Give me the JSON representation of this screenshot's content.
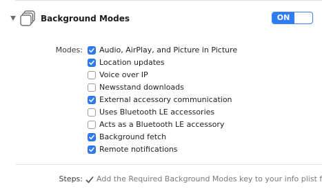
{
  "capability": {
    "title": "Background Modes",
    "toggle_label": "ON",
    "toggle_state": "on",
    "icon": "layered-squares-icon",
    "disclosure_icon": "disclosure-triangle-down-icon"
  },
  "modes": {
    "label": "Modes:",
    "items": [
      {
        "label": "Audio, AirPlay, and Picture in Picture",
        "checked": true
      },
      {
        "label": "Location updates",
        "checked": true
      },
      {
        "label": "Voice over IP",
        "checked": false
      },
      {
        "label": "Newsstand downloads",
        "checked": false
      },
      {
        "label": "External accessory communication",
        "checked": true
      },
      {
        "label": "Uses Bluetooth LE accessories",
        "checked": false
      },
      {
        "label": "Acts as a Bluetooth LE accessory",
        "checked": false
      },
      {
        "label": "Background fetch",
        "checked": true
      },
      {
        "label": "Remote notifications",
        "checked": true
      }
    ]
  },
  "steps": {
    "label": "Steps:",
    "icon": "checkmark-icon",
    "text": "Add the Required Background Modes key to your info plist fil"
  },
  "colors": {
    "accent": "#2f7cf6",
    "checkbox_border": "#9c9c9c",
    "secondary_text": "#7a7a7a"
  }
}
